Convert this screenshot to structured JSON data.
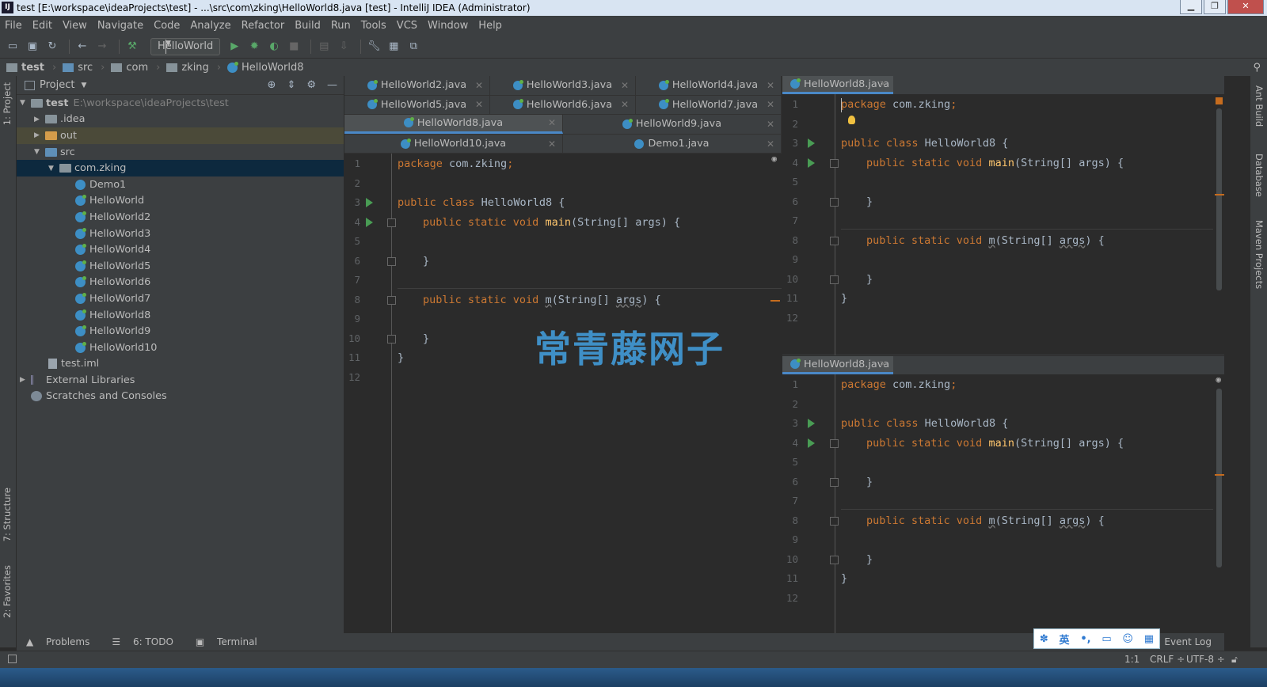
{
  "window": {
    "title": "test [E:\\workspace\\ideaProjects\\test] - ...\\src\\com\\zking\\HelloWorld8.java [test] - IntelliJ IDEA (Administrator)",
    "app_icon": "IJ"
  },
  "menu": [
    "File",
    "Edit",
    "View",
    "Navigate",
    "Code",
    "Analyze",
    "Refactor",
    "Build",
    "Run",
    "Tools",
    "VCS",
    "Window",
    "Help"
  ],
  "toolbar": {
    "run_config": "HelloWorld"
  },
  "breadcrumb": [
    "test",
    "src",
    "com",
    "zking",
    "HelloWorld8"
  ],
  "side_tabs_left": {
    "project": "1: Project",
    "structure": "7: Structure",
    "favorites": "2: Favorites"
  },
  "side_tabs_right": {
    "ant": "Ant Build",
    "database": "Database",
    "maven": "Maven Projects"
  },
  "project_panel": {
    "title": "Project",
    "root": {
      "name": "test",
      "path": "E:\\workspace\\ideaProjects\\test"
    },
    "items": [
      ".idea",
      "out",
      "src",
      "com.zking",
      "Demo1",
      "HelloWorld",
      "HelloWorld2",
      "HelloWorld3",
      "HelloWorld4",
      "HelloWorld5",
      "HelloWorld6",
      "HelloWorld7",
      "HelloWorld8",
      "HelloWorld9",
      "HelloWorld10",
      "test.iml",
      "External Libraries",
      "Scratches and Consoles"
    ]
  },
  "editor_tabs": {
    "row1": [
      "HelloWorld2.java",
      "HelloWorld3.java",
      "HelloWorld4.java"
    ],
    "row2": [
      "HelloWorld5.java",
      "HelloWorld6.java",
      "HelloWorld7.java"
    ],
    "row3": [
      "HelloWorld8.java",
      "HelloWorld9.java"
    ],
    "row4": [
      "HelloWorld10.java",
      "Demo1.java"
    ],
    "split_top": "HelloWorld8.java",
    "split_bottom": "HelloWorld8.java"
  },
  "code": {
    "line_numbers": [
      "1",
      "2",
      "3",
      "4",
      "5",
      "6",
      "7",
      "8",
      "9",
      "10",
      "11",
      "12"
    ],
    "package_kw": "package",
    "package_name": " com.zking",
    "semicolon": ";",
    "public_class": "public class",
    "class_name": " HelloWorld8 {",
    "public_static_void": "public static void",
    "main": "main",
    "main_args": "(String[] args) {",
    "m": "m",
    "m_args_pre": "(String[] ",
    "args": "args",
    "m_args_post": ") {",
    "close_brace": "}"
  },
  "watermark": "常青藤网子",
  "bottom_tools": {
    "problems": "Problems",
    "todo": "6: TODO",
    "terminal": "Terminal",
    "event_log": "Event Log"
  },
  "status": {
    "position": "1:1",
    "line_sep": "CRLF ÷",
    "encoding": "UTF-8 ÷"
  },
  "ime": {
    "lang": "英"
  }
}
